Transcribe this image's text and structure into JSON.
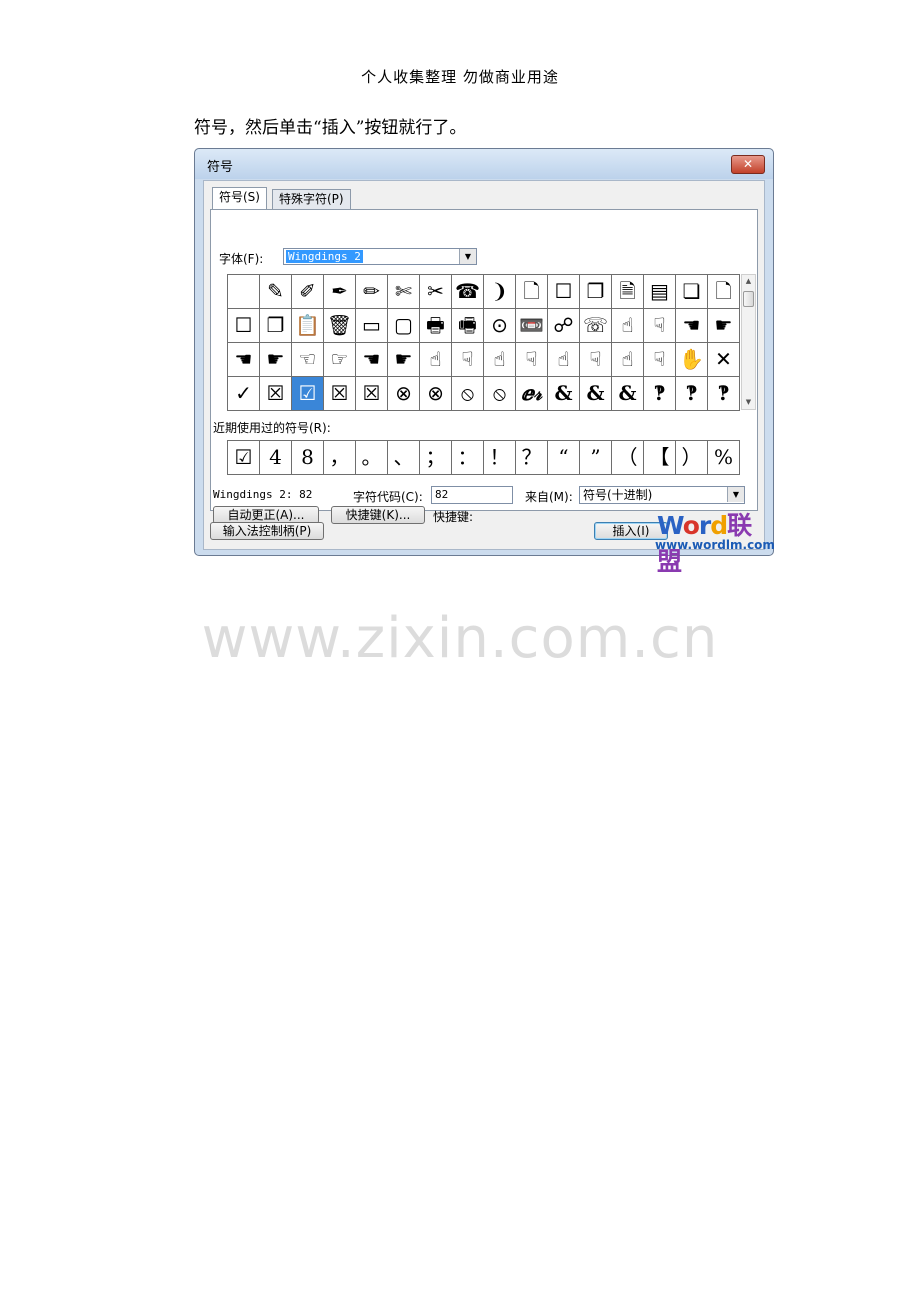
{
  "doc": {
    "header": "个人收集整理 勿做商业用途",
    "intro": "符号，然后单击“插入”按钮就行了。",
    "watermark": "www.zixin.com.cn"
  },
  "dialog": {
    "title": "符号",
    "close_glyph": "✕",
    "tabs": [
      "符号(S)",
      "特殊字符(P)"
    ],
    "font_label": "字体(F):",
    "font_value": "Wingdings 2",
    "dropdown_glyph": "▼",
    "symbol_rows": [
      [
        "",
        "✎",
        "✐",
        "✒",
        "✏",
        "✄",
        "✂",
        "☎",
        "❩",
        "🗋",
        "☐",
        "❐",
        "🗎",
        "▤",
        "❏",
        "🗋"
      ],
      [
        "☐",
        "❐",
        "📋",
        "🗑",
        "▭",
        "▢",
        "🖶",
        "🖷",
        "⊙",
        "📼",
        "☍",
        "☏",
        "☝",
        "☟",
        "☚",
        "☛"
      ],
      [
        "☚",
        "☛",
        "☜",
        "☞",
        "☚",
        "☛",
        "☝",
        "☟",
        "☝",
        "☟",
        "☝",
        "☟",
        "☝",
        "☟",
        "✋",
        "✕"
      ],
      [
        "✓",
        "☒",
        "☑",
        "☒",
        "☒",
        "⊗",
        "⊗",
        "⦸",
        "⦸",
        "ⅇ𝓇",
        "&",
        "&",
        "&",
        "‽",
        "‽",
        "‽"
      ]
    ],
    "selected_cell": "3-2",
    "scroll_up": "▲",
    "scroll_down": "▼",
    "recent_label": "近期使用过的符号(R):",
    "recent_symbols": [
      "☑",
      "4",
      "8",
      "，",
      "。",
      "、",
      "；",
      "：",
      "！",
      "？",
      "“",
      "”",
      "（",
      "【",
      "）",
      "%"
    ],
    "char_name": "Wingdings 2: 82",
    "code_label": "字符代码(C):",
    "code_value": "82",
    "from_label": "来自(M):",
    "from_value": "符号(十进制)",
    "autocorrect_button": "自动更正(A)...",
    "shortcut_button": "快捷键(K)...",
    "shortcut_label": "快捷键:",
    "ime_button": "输入法控制柄(P)",
    "insert_button": "插入(I)",
    "brand_logo": "Word联盟",
    "brand_url": "www.wordlm.com"
  }
}
